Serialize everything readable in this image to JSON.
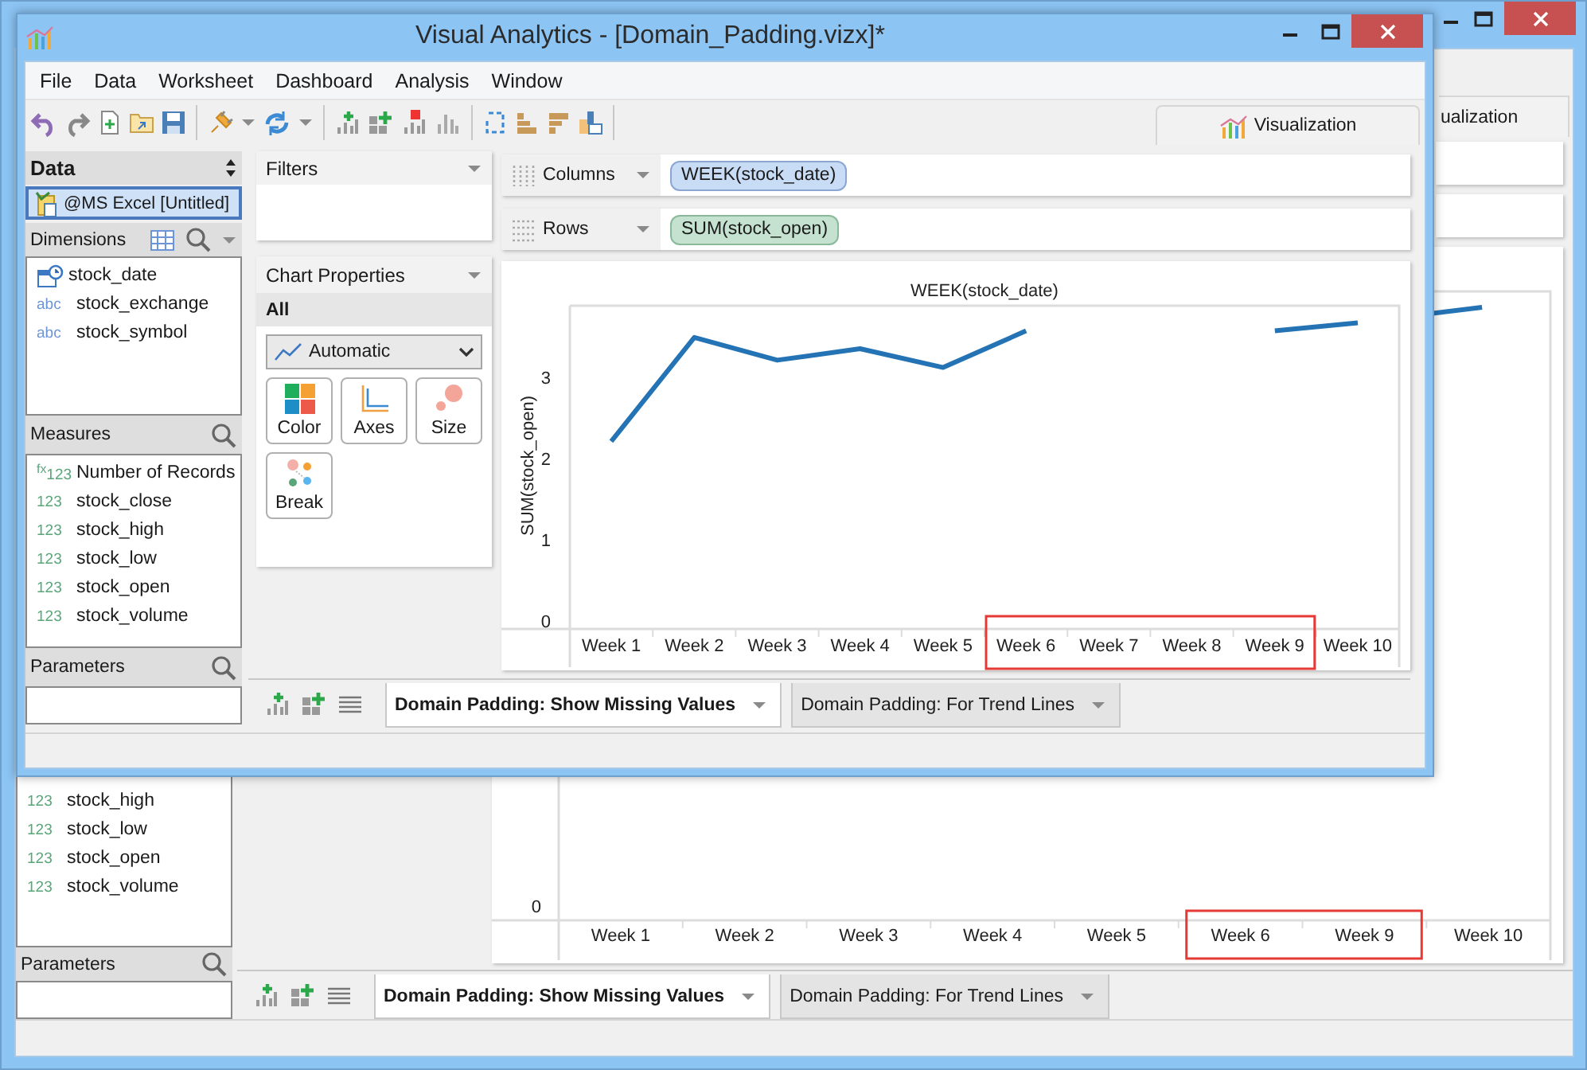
{
  "background_window": {
    "view_tab": "ualization",
    "measures": [
      {
        "kind": "number",
        "badge": "123",
        "name": "stock_high"
      },
      {
        "kind": "number",
        "badge": "123",
        "name": "stock_low"
      },
      {
        "kind": "number",
        "badge": "123",
        "name": "stock_open"
      },
      {
        "kind": "number",
        "badge": "123",
        "name": "stock_volume"
      }
    ],
    "parameters": {
      "title": "Parameters"
    },
    "chart": {
      "y_ticks": [
        "0"
      ],
      "x_labels": [
        "Week 1",
        "Week 2",
        "Week 3",
        "Week 4",
        "Week 5",
        "Week 6",
        "Week 9",
        "Week 10"
      ]
    },
    "sheet_tabs": [
      {
        "label": "Domain Padding: Show Missing Values",
        "selected": true
      },
      {
        "label": "Domain Padding: For Trend Lines",
        "selected": false
      }
    ]
  },
  "window": {
    "title": "Visual Analytics - [Domain_Padding.vizx]*",
    "menu": [
      "File",
      "Data",
      "Worksheet",
      "Dashboard",
      "Analysis",
      "Window"
    ],
    "view_tab": "Visualization",
    "data_panel": {
      "title": "Data",
      "source": {
        "label": "@MS Excel [Untitled]",
        "selected": true
      }
    },
    "dimensions": {
      "title": "Dimensions",
      "fields": [
        {
          "kind": "date",
          "name": "stock_date"
        },
        {
          "kind": "string",
          "badge": "abc",
          "name": "stock_exchange"
        },
        {
          "kind": "string",
          "badge": "abc",
          "name": "stock_symbol"
        }
      ]
    },
    "measures": {
      "title": "Measures",
      "fields": [
        {
          "kind": "number",
          "badge": "$^{fx}$123",
          "name": "Number of Records"
        },
        {
          "kind": "number",
          "badge": "123",
          "name": "stock_close"
        },
        {
          "kind": "number",
          "badge": "123",
          "name": "stock_high"
        },
        {
          "kind": "number",
          "badge": "123",
          "name": "stock_low"
        },
        {
          "kind": "number",
          "badge": "123",
          "name": "stock_open"
        },
        {
          "kind": "number",
          "badge": "123",
          "name": "stock_volume"
        }
      ]
    },
    "parameters": {
      "title": "Parameters"
    },
    "filters": {
      "title": "Filters"
    },
    "chart_properties": {
      "title": "Chart Properties",
      "scope": "All",
      "mark_type": "Automatic",
      "buttons": [
        {
          "kind": "color",
          "label": "Color"
        },
        {
          "kind": "axes",
          "label": "Axes"
        },
        {
          "kind": "size",
          "label": "Size"
        },
        {
          "kind": "break",
          "label": "Break"
        }
      ]
    },
    "shelves": [
      {
        "kind": "columns",
        "label": "Columns",
        "pill": "WEEK(stock_date)"
      },
      {
        "kind": "rows",
        "label": "Rows",
        "pill": "SUM(stock_open)"
      }
    ],
    "chart": {
      "chart_data": {
        "type": "line",
        "title": "WEEK(stock_date)",
        "ylabel": "SUM(stock_open)",
        "categories": [
          "Week 1",
          "Week 2",
          "Week 3",
          "Week 4",
          "Week 5",
          "Week 6",
          "Week 7",
          "Week 8",
          "Week 9",
          "Week 10"
        ],
        "series": [
          {
            "color": "#2473b4",
            "values": [
              2.27,
              3.55,
              3.27,
              3.41,
              3.18,
              3.63,
              null,
              null,
              3.63,
              3.73
            ]
          }
        ],
        "ylim": [
          0,
          3.94
        ],
        "yticks": [
          0,
          1,
          2,
          3
        ]
      }
    },
    "sheet_tabs": [
      {
        "label": "Domain Padding: Show Missing Values",
        "selected": true
      },
      {
        "label": "Domain Padding: For Trend Lines",
        "selected": false
      }
    ]
  }
}
